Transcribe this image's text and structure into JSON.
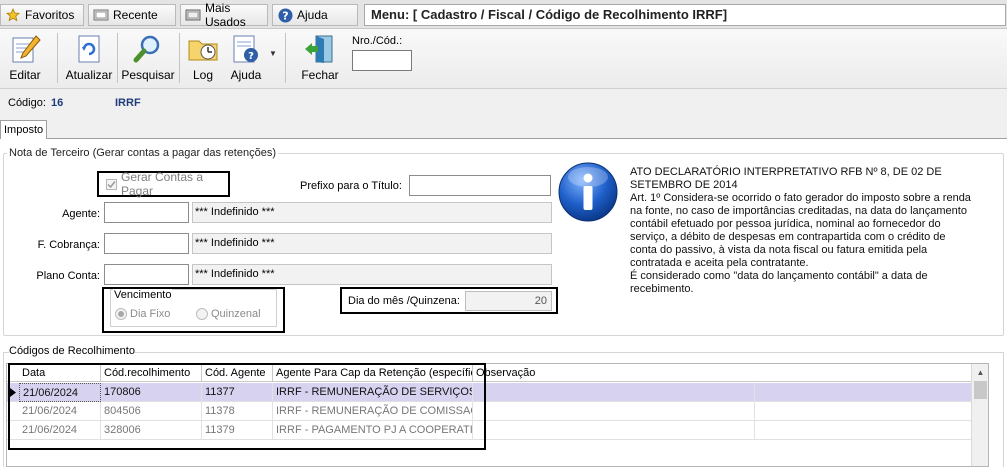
{
  "topbar": {
    "tabs": [
      {
        "label": "Favoritos",
        "icon": "star-icon"
      },
      {
        "label": "Recente",
        "icon": "recent-icon"
      },
      {
        "label": "Mais Usados",
        "icon": "most-used-icon"
      },
      {
        "label": "Ajuda",
        "icon": "help-icon"
      }
    ],
    "menu_title": "Menu: [ Cadastro / Fiscal / Código de Recolhimento IRRF]"
  },
  "toolbar": {
    "buttons": [
      {
        "label": "Editar",
        "icon": "edit-icon"
      },
      {
        "label": "Atualizar",
        "icon": "refresh-icon"
      },
      {
        "label": "Pesquisar",
        "icon": "search-icon"
      },
      {
        "label": "Log",
        "icon": "log-folder-icon"
      },
      {
        "label": "Ajuda",
        "icon": "help-doc-icon"
      },
      {
        "label": "Fechar",
        "icon": "exit-door-icon"
      }
    ],
    "nro_cod_label": "Nro./Cód.:",
    "nro_cod_value": ""
  },
  "record": {
    "codigo_label": "Código:",
    "codigo_value": "16",
    "name": "IRRF"
  },
  "tabs": {
    "active": "Imposto"
  },
  "nota_terceiro": {
    "title": "Nota de Terceiro (Gerar contas a pagar das retenções)",
    "gerar_contas_label": "Gerar Contas a Pagar",
    "gerar_contas_checked": true,
    "prefixo_label": "Prefixo para o Título:",
    "prefixo_value": "",
    "agente_label": "Agente:",
    "agente_code": "",
    "agente_desc": "*** Indefinido ***",
    "cobranca_label": "F. Cobrança:",
    "cobranca_code": "",
    "cobranca_desc": "*** Indefinido ***",
    "plano_label": "Plano Conta:",
    "plano_code": "",
    "plano_desc": "*** Indefinido ***",
    "vencimento_title": "Vencimento",
    "dia_fixo_label": "Dia Fixo",
    "quinzenal_label": "Quinzenal",
    "selected_vencimento": "Dia Fixo",
    "dia_mes_label": "Dia do mês /Quinzena:",
    "dia_mes_value": "20"
  },
  "info": {
    "icon": "info-icon",
    "lines": [
      "ATO DECLARATÓRIO INTERPRETATIVO RFB Nº 8, DE 02 DE SETEMBRO DE 2014",
      "Art. 1º Considera-se ocorrido o fato gerador do imposto sobre a renda na fonte, no caso de importâncias creditadas, na data do lançamento contábil efetuado por pessoa jurídica, nominal ao fornecedor do serviço, a débito de despesas em contrapartida com o crédito de conta do passivo, à vista da nota fiscal ou fatura emitida pela contratada e aceita pela contratante.",
      "É considerado como \"data do lançamento contábil\" a data de recebimento."
    ]
  },
  "codigos": {
    "title": "Códigos de Recolhimento",
    "columns": [
      "Data",
      "Cód.recolhimento",
      "Cód. Agente",
      "Agente Para Cap da Retenção (específico)",
      "Observação"
    ],
    "rows": [
      [
        "21/06/2024",
        "170806",
        "11377",
        "IRRF - REMUNERAÇÃO DE SERVIÇOS PRE",
        ""
      ],
      [
        "21/06/2024",
        "804506",
        "11378",
        "IRRF - REMUNERAÇÃO DE COMISSAO RE",
        ""
      ],
      [
        "21/06/2024",
        "328006",
        "11379",
        "IRRF - PAGAMENTO PJ A COOPERATIVA",
        ""
      ]
    ],
    "selected_row": 0
  }
}
